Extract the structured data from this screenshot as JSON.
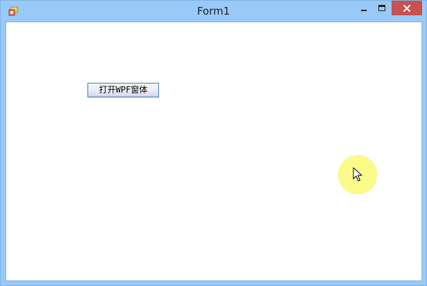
{
  "window": {
    "title": "Form1",
    "app_icon": "winforms-app-icon",
    "controls": {
      "minimize_icon": "minimize-icon",
      "maximize_icon": "maximize-icon",
      "close_icon": "close-icon"
    }
  },
  "form": {
    "open_wpf_button_label": "打开WPF窗体"
  },
  "cursor": {
    "icon": "mouse-pointer-icon",
    "highlight_color": "#fbfb8a"
  },
  "colors": {
    "titlebar": "#99c9f7",
    "close_button": "#c75050",
    "client_background": "#ffffff"
  }
}
